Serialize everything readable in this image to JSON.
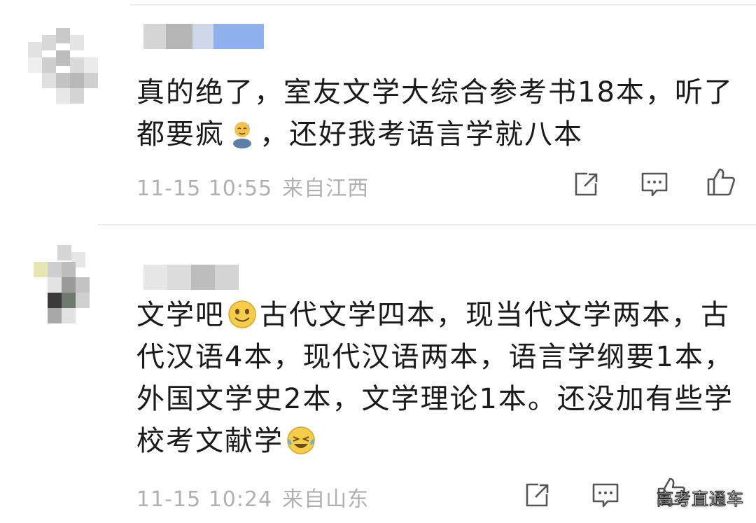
{
  "comments": [
    {
      "content": [
        {
          "type": "text",
          "value": "真的绝了，室友文学大综合参考书18本，听了都要疯"
        },
        {
          "type": "emoji",
          "name": "sweating-emoji"
        },
        {
          "type": "text",
          "value": "，还好我考语言学就八本"
        }
      ],
      "date": "11-15 10:55",
      "location": "来自江西"
    },
    {
      "content": [
        {
          "type": "text",
          "value": "文学吧"
        },
        {
          "type": "emoji",
          "name": "smile-emoji"
        },
        {
          "type": "text",
          "value": "古代文学四本，现当代文学两本，古代汉语4本，现代汉语两本，语言学纲要1本，外国文学史2本，文学理论1本。还没加有些学校考文献学"
        },
        {
          "type": "emoji",
          "name": "laughing-crying-emoji"
        }
      ],
      "date": "11-15 10:24",
      "location": "来自山东"
    }
  ],
  "icons": {
    "share": "share-icon",
    "reply": "comment-icon",
    "like": "thumbs-up-icon"
  },
  "colors": {
    "text": "#1a1a1a",
    "meta": "#b0b0b0",
    "icon": "#555555",
    "divider": "#ececec"
  },
  "watermark": "高考直通车"
}
